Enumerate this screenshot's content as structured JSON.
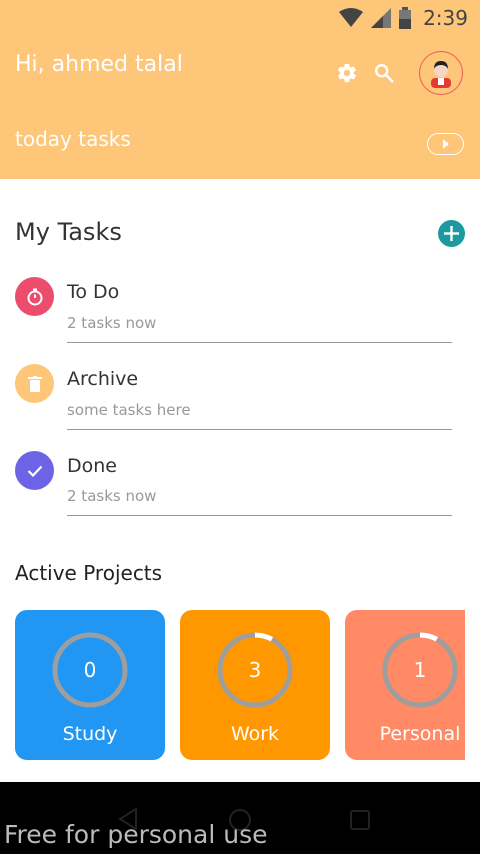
{
  "status": {
    "time": "2:39"
  },
  "header": {
    "greeting": "Hi, ahmed talal",
    "today_label": "today tasks"
  },
  "tasks_section": {
    "title": "My Tasks",
    "items": [
      {
        "title": "To Do",
        "subtitle": "2 tasks now",
        "icon": "stopwatch-icon",
        "color": "#ec4d6d"
      },
      {
        "title": "Archive",
        "subtitle": "some tasks here",
        "icon": "trash-icon",
        "color": "#fdc678"
      },
      {
        "title": "Done",
        "subtitle": "2 tasks now",
        "icon": "check-icon",
        "color": "#6c63e6"
      }
    ]
  },
  "projects_section": {
    "title": "Active Projects",
    "cards": [
      {
        "count": "0",
        "label": "Study",
        "color": "#2196f3",
        "progress": 0.0
      },
      {
        "count": "3",
        "label": "Work",
        "color": "#ff9800",
        "progress": 0.08
      },
      {
        "count": "1",
        "label": "Personal",
        "color": "#ff8a65",
        "progress": 0.08
      }
    ]
  },
  "watermark": "Free for personal use"
}
